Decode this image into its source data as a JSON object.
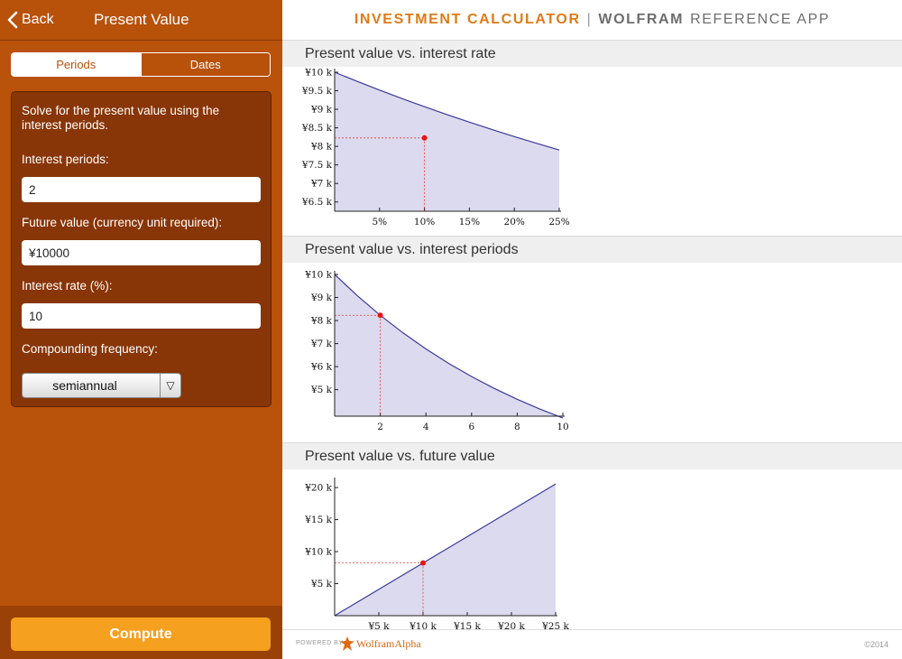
{
  "nav": {
    "back_label": "Back",
    "title": "Present Value"
  },
  "tabs": [
    {
      "label": "Periods",
      "selected": true
    },
    {
      "label": "Dates",
      "selected": false
    }
  ],
  "form": {
    "description": "Solve for the present value using the interest periods.",
    "periods_label": "Interest periods:",
    "periods_value": "2",
    "future_label": "Future value (currency unit required):",
    "future_value": "¥10000",
    "rate_label": "Interest rate (%):",
    "rate_value": "10",
    "freq_label": "Compounding frequency:",
    "freq_value": "semiannual"
  },
  "compute_label": "Compute",
  "header": {
    "part1": "INVESTMENT CALCULATOR",
    "separator": "|",
    "part2": "WOLFRAM",
    "part3": "REFERENCE APP"
  },
  "footer": {
    "powered": "POWERED BY",
    "brand": "WolframAlpha",
    "copyright": "©2014"
  },
  "colors": {
    "panel": "#b9520a",
    "form_bg": "#883507",
    "compute": "#f5a01e",
    "curve": "#3b3b9a",
    "fill": "#dcdaee",
    "marker": "#ee1111"
  },
  "chart_data": [
    {
      "type": "area",
      "title": "Present value vs. interest rate",
      "x_ticks": [
        5,
        10,
        15,
        20,
        25
      ],
      "x_tick_labels": [
        "5%",
        "10%",
        "15%",
        "20%",
        "25%"
      ],
      "y_ticks": [
        6500,
        7000,
        7500,
        8000,
        8500,
        9000,
        9500,
        10000
      ],
      "y_tick_labels": [
        "¥6.5 k",
        "¥7 k",
        "¥7.5 k",
        "¥8 k",
        "¥8.5 k",
        "¥9 k",
        "¥9.5 k",
        "¥10 k"
      ],
      "xlim": [
        0,
        25
      ],
      "ylim": [
        6250,
        10000
      ],
      "x": [
        0,
        2.5,
        5,
        7.5,
        10,
        12.5,
        15,
        17.5,
        20,
        22.5,
        25
      ],
      "y": [
        10000,
        9755,
        9518,
        9290,
        9070,
        8858,
        8653,
        8455,
        8264,
        8080,
        7901
      ],
      "marker": {
        "x": 10,
        "y": 8227
      }
    },
    {
      "type": "area",
      "title": "Present value vs. interest periods",
      "x_ticks": [
        2,
        4,
        6,
        8,
        10
      ],
      "x_tick_labels": [
        "2",
        "4",
        "6",
        "8",
        "10"
      ],
      "y_ticks": [
        5000,
        6000,
        7000,
        8000,
        9000,
        10000
      ],
      "y_tick_labels": [
        "¥5 k",
        "¥6 k",
        "¥7 k",
        "¥8 k",
        "¥9 k",
        "¥10 k"
      ],
      "xlim": [
        0,
        10
      ],
      "ylim": [
        3850,
        10000
      ],
      "x": [
        0,
        1,
        2,
        3,
        4,
        5,
        6,
        7,
        8,
        9,
        10
      ],
      "y": [
        10000,
        9070,
        8227,
        7462,
        6768,
        6139,
        5568,
        5051,
        4581,
        4155,
        3769
      ],
      "marker": {
        "x": 2,
        "y": 8227
      }
    },
    {
      "type": "area",
      "title": "Present value vs. future value",
      "x_ticks": [
        5000,
        10000,
        15000,
        20000,
        25000
      ],
      "x_tick_labels": [
        "¥5 k",
        "¥10 k",
        "¥15 k",
        "¥20 k",
        "¥25 k"
      ],
      "y_ticks": [
        5000,
        10000,
        15000,
        20000
      ],
      "y_tick_labels": [
        "¥5 k",
        "¥10 k",
        "¥15 k",
        "¥20 k"
      ],
      "xlim": [
        0,
        25000
      ],
      "ylim": [
        0,
        21000
      ],
      "x": [
        0,
        25000
      ],
      "y": [
        0,
        20568
      ],
      "marker": {
        "x": 10000,
        "y": 8227
      }
    }
  ]
}
